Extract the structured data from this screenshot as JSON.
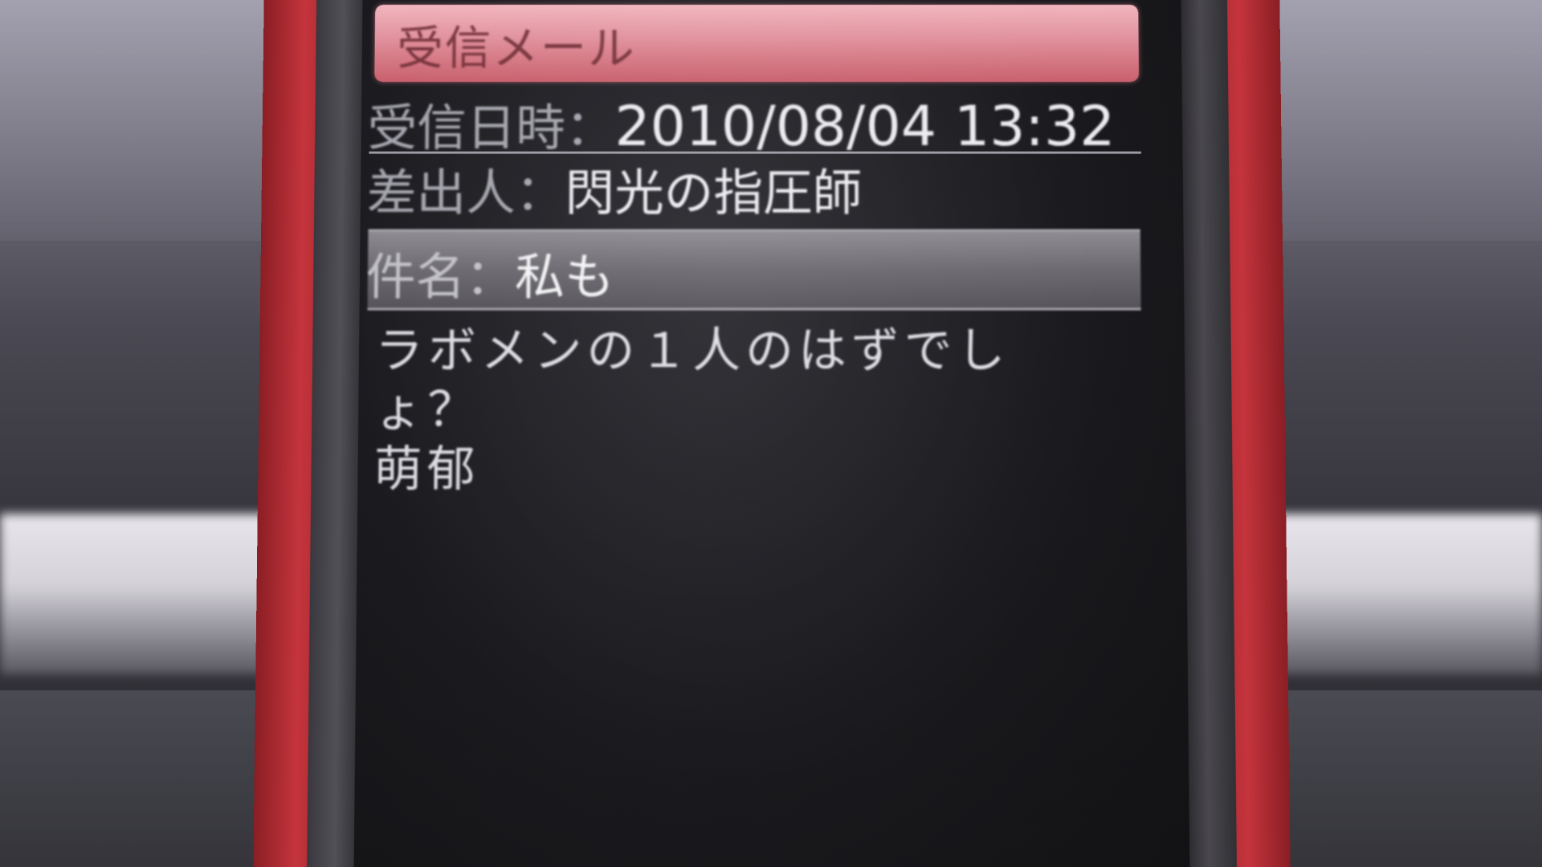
{
  "header": {
    "title": "受信メール"
  },
  "fields": {
    "received_label": "受信日時：",
    "received_value": "2010/08/04 13:32",
    "from_label": "差出人：",
    "from_value": "閃光の指圧師",
    "subject_label": "件名：",
    "subject_value": "私も"
  },
  "body": {
    "lines": [
      "ラボメンの１人のはずでし",
      "ょ？",
      "萌郁"
    ]
  },
  "colors": {
    "phone_body": "#b02c34",
    "title_bar": "#e0909c",
    "screen_bg": "#1a1a1e",
    "subject_highlight": "#6c6a70"
  }
}
